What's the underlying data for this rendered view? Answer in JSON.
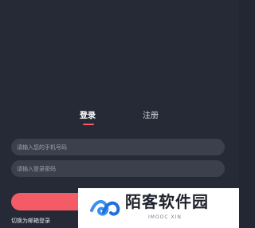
{
  "tabs": {
    "login_label": "登录",
    "register_label": "注册"
  },
  "form": {
    "phone_placeholder": "请输入您的手机号码",
    "password_placeholder": "请输入登录密码",
    "login_button_label": "",
    "switch_label": "切换为邮箱登录"
  },
  "watermark": {
    "title": "陌客软件园",
    "subtitle": "IMOOC XIN",
    "icon": "wave-logo-icon"
  },
  "colors": {
    "background": "#252a36",
    "accent": "#f45b64",
    "input_background": "#3b404c"
  }
}
